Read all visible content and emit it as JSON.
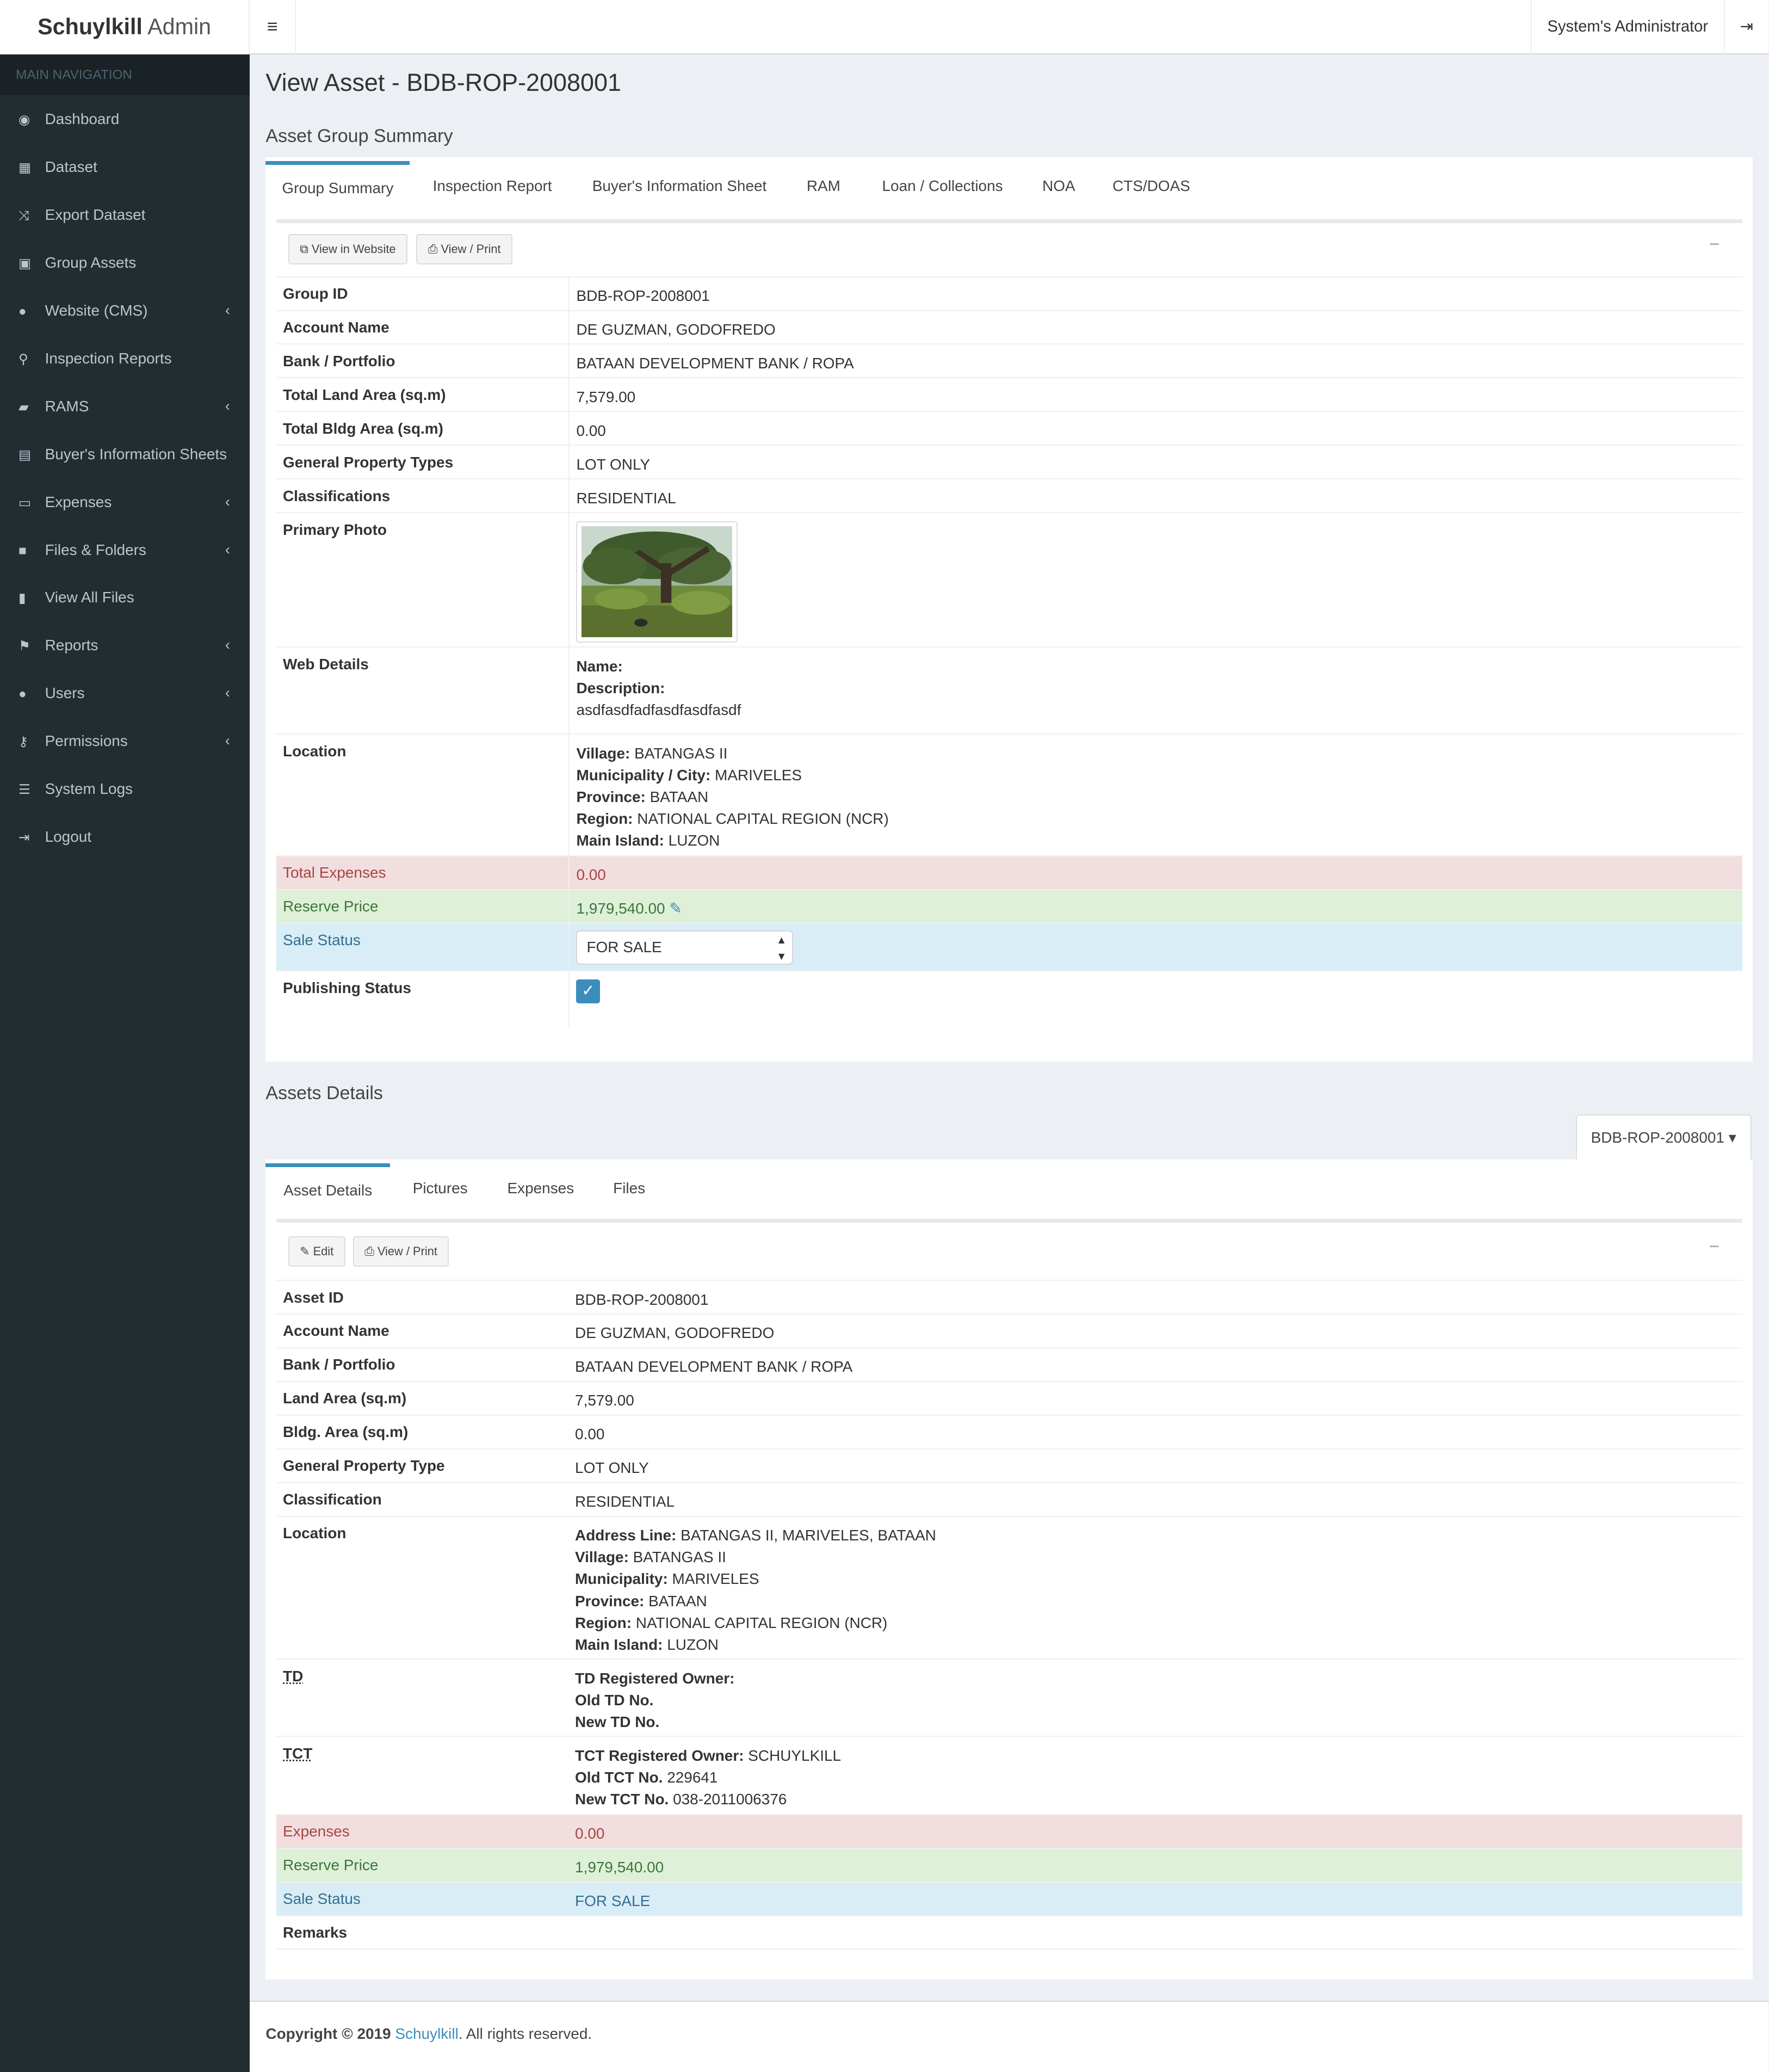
{
  "app": {
    "brand_bold": "Schuylkill",
    "brand_light": "Admin",
    "user": "System's Administrator"
  },
  "sidebar": {
    "header": "MAIN NAVIGATION",
    "items": [
      {
        "label": "Dashboard",
        "icon": "dashboard-icon"
      },
      {
        "label": "Dataset",
        "icon": "table-icon"
      },
      {
        "label": "Export Dataset",
        "icon": "random-icon"
      },
      {
        "label": "Group Assets",
        "icon": "object-group-icon"
      },
      {
        "label": "Website (CMS)",
        "icon": "globe-icon"
      },
      {
        "label": "Inspection Reports",
        "icon": "search-icon"
      },
      {
        "label": "RAMS",
        "icon": "book-icon"
      },
      {
        "label": "Buyer's Information Sheets",
        "icon": "id-card-icon"
      },
      {
        "label": "Expenses",
        "icon": "credit-card-icon"
      },
      {
        "label": "Files & Folders",
        "icon": "folder-icon"
      },
      {
        "label": "View All Files",
        "icon": "file-icon"
      },
      {
        "label": "Reports",
        "icon": "flag-icon"
      },
      {
        "label": "Users",
        "icon": "users-icon"
      },
      {
        "label": "Permissions",
        "icon": "key-icon"
      },
      {
        "label": "System Logs",
        "icon": "list-icon"
      },
      {
        "label": "Logout",
        "icon": "sign-out-icon"
      }
    ]
  },
  "page": {
    "title": "View Asset - BDB-ROP-2008001",
    "group_section": "Asset Group Summary",
    "assets_section": "Assets Details"
  },
  "group_tabs": [
    "Group Summary",
    "Inspection Report",
    "Buyer's Information Sheet",
    "RAM",
    "Loan / Collections",
    "NOA",
    "CTS/DOAS"
  ],
  "group_buttons": {
    "view_website": "View in Website",
    "view_print": "View / Print"
  },
  "group": {
    "group_id": {
      "label": "Group ID",
      "value": "BDB-ROP-2008001"
    },
    "account_name": {
      "label": "Account Name",
      "value": "DE GUZMAN, GODOFREDO"
    },
    "bank": {
      "label": "Bank / Portfolio",
      "value": "BATAAN DEVELOPMENT BANK / ROPA"
    },
    "land_area": {
      "label": "Total Land Area (sq.m)",
      "value": "7,579.00"
    },
    "bldg_area": {
      "label": "Total Bldg Area (sq.m)",
      "value": "0.00"
    },
    "property_types": {
      "label": "General Property Types",
      "value": "LOT ONLY"
    },
    "classifications": {
      "label": "Classifications",
      "value": "RESIDENTIAL"
    },
    "primary_photo": {
      "label": "Primary Photo"
    },
    "web_details": {
      "label": "Web Details",
      "name_key": "Name:",
      "desc_key": "Description:",
      "desc_value": "asdfasdfadfasdfasdfasdf"
    },
    "location": {
      "label": "Location",
      "village_key": "Village:",
      "village": "BATANGAS II",
      "city_key": "Municipality / City:",
      "city": "MARIVELES",
      "province_key": "Province:",
      "province": "BATAAN",
      "region_key": "Region:",
      "region": "NATIONAL CAPITAL REGION (NCR)",
      "island_key": "Main Island:",
      "island": "LUZON"
    },
    "total_expenses": {
      "label": "Total Expenses",
      "value": "0.00"
    },
    "reserve_price": {
      "label": "Reserve Price",
      "value": "1,979,540.00"
    },
    "sale_status": {
      "label": "Sale Status",
      "value": "FOR SALE"
    },
    "publishing_status": {
      "label": "Publishing Status",
      "checked": true
    }
  },
  "asset_dropdown": "BDB-ROP-2008001",
  "asset_tabs": [
    "Asset Details",
    "Pictures",
    "Expenses",
    "Files"
  ],
  "asset_buttons": {
    "edit": "Edit",
    "view_print": "View / Print"
  },
  "asset": {
    "asset_id": {
      "label": "Asset ID",
      "value": "BDB-ROP-2008001"
    },
    "account_name": {
      "label": "Account Name",
      "value": "DE GUZMAN, GODOFREDO"
    },
    "bank": {
      "label": "Bank / Portfolio",
      "value": "BATAAN DEVELOPMENT BANK / ROPA"
    },
    "land_area": {
      "label": "Land Area (sq.m)",
      "value": "7,579.00"
    },
    "bldg_area": {
      "label": "Bldg. Area (sq.m)",
      "value": "0.00"
    },
    "property_type": {
      "label": "General Property Type",
      "value": "LOT ONLY"
    },
    "classification": {
      "label": "Classification",
      "value": "RESIDENTIAL"
    },
    "location": {
      "label": "Location",
      "address_key": "Address Line:",
      "address": "BATANGAS II, MARIVELES, BATAAN",
      "village_key": "Village:",
      "village": "BATANGAS II",
      "municipality_key": "Municipality:",
      "municipality": "MARIVELES",
      "province_key": "Province:",
      "province": "BATAAN",
      "region_key": "Region:",
      "region": "NATIONAL CAPITAL REGION (NCR)",
      "island_key": "Main Island:",
      "island": "LUZON"
    },
    "td": {
      "label": "TD",
      "owner_key": "TD Registered Owner:",
      "old_key": "Old TD No.",
      "new_key": "New TD No."
    },
    "tct": {
      "label": "TCT",
      "owner_key": "TCT Registered Owner:",
      "owner": "SCHUYLKILL",
      "old_key": "Old TCT No.",
      "old": "229641",
      "new_key": "New TCT No.",
      "new": "038-2011006376"
    },
    "expenses": {
      "label": "Expenses",
      "value": "0.00"
    },
    "reserve_price": {
      "label": "Reserve Price",
      "value": "1,979,540.00"
    },
    "sale_status": {
      "label": "Sale Status",
      "value": "FOR SALE"
    },
    "remarks": {
      "label": "Remarks"
    }
  },
  "footer": {
    "copyright": "Copyright © 2019",
    "company": "Schuylkill",
    "rights": ". All rights reserved."
  },
  "colors": {
    "accent": "#3c8dbc",
    "sidebar": "#222d32",
    "danger_bg": "#f2dede",
    "success_bg": "#dff0d8",
    "info_bg": "#d9edf7"
  }
}
